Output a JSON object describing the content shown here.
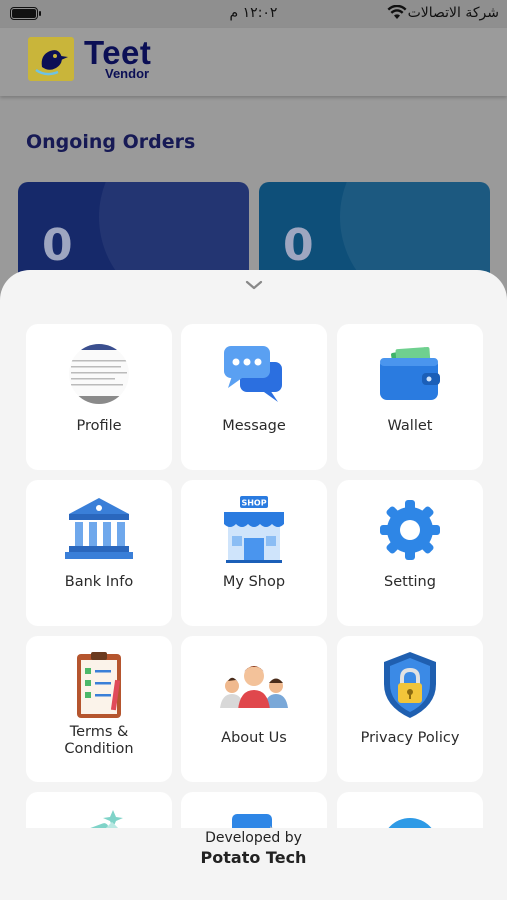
{
  "status_bar": {
    "time": "١٢:٠٢ م",
    "carrier": "شركة الاتصالات"
  },
  "header": {
    "logo_title": "Teet",
    "logo_subtitle": "Vendor"
  },
  "dashboard": {
    "section_title": "Ongoing Orders",
    "cards": [
      {
        "value": "0"
      },
      {
        "value": "0"
      }
    ]
  },
  "menu": {
    "items": [
      {
        "label": "Profile",
        "icon": "profile-avatar-icon"
      },
      {
        "label": "Message",
        "icon": "chat-bubbles-icon"
      },
      {
        "label": "Wallet",
        "icon": "wallet-icon"
      },
      {
        "label": "Bank Info",
        "icon": "bank-icon"
      },
      {
        "label": "My Shop",
        "icon": "shop-icon"
      },
      {
        "label": "Setting",
        "icon": "gear-icon"
      },
      {
        "label": "Terms & Condition",
        "line1": "Terms &",
        "line2": "Condition",
        "icon": "clipboard-checklist-icon"
      },
      {
        "label": "About Us",
        "icon": "people-group-icon"
      },
      {
        "label": "Privacy Policy",
        "icon": "shield-lock-icon"
      }
    ]
  },
  "footer": {
    "developed_by": "Developed by",
    "company": "Potato Tech"
  },
  "colors": {
    "brand_navy": "#0b0f55",
    "icon_blue": "#2e86e6",
    "sheet_bg": "#f4f4f4",
    "card_left": "#16296a",
    "card_right": "#0e4f79"
  }
}
